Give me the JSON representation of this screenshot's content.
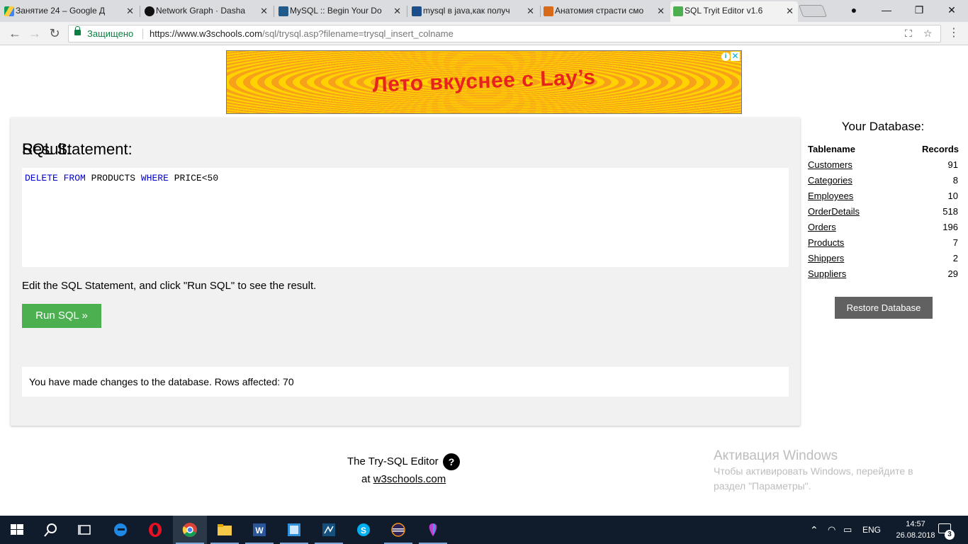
{
  "browser": {
    "tabs": [
      {
        "title": "Занятие 24 – Google Д",
        "icon": "google-drive-icon"
      },
      {
        "title": "Network Graph · Dasha",
        "icon": "github-icon"
      },
      {
        "title": "MySQL :: Begin Your Do",
        "icon": "mysql-icon"
      },
      {
        "title": "mysql в java,как получ",
        "icon": "stackoverflow-icon"
      },
      {
        "title": "Анатомия страсти смо",
        "icon": "fox-icon"
      },
      {
        "title": "SQL Tryit Editor v1.6",
        "icon": "w3schools-icon"
      }
    ],
    "secure_label": "Защищено",
    "url_host": "https://www.w3schools.com",
    "url_path": "/sql/trysql.asp?filename=trysql_insert_colname"
  },
  "ad": {
    "text": "Лето вкуснее с Lay’s"
  },
  "editor": {
    "heading": "SQL Statement:",
    "sql_kw1": "DELETE",
    "sql_kw2": "FROM",
    "sql_table": "PRODUCTS",
    "sql_kw3": "WHERE",
    "sql_cond": "PRICE<50",
    "hint": "Edit the SQL Statement, and click \"Run SQL\" to see the result.",
    "run_label": "Run SQL »",
    "result_heading": "Result:",
    "result_text": "You have made changes to the database. Rows affected: 70"
  },
  "database": {
    "title": "Your Database:",
    "col_name": "Tablename",
    "col_records": "Records",
    "tables": [
      {
        "name": "Customers",
        "records": "91"
      },
      {
        "name": "Categories",
        "records": "8"
      },
      {
        "name": "Employees",
        "records": "10"
      },
      {
        "name": "OrderDetails",
        "records": "518"
      },
      {
        "name": "Orders",
        "records": "196"
      },
      {
        "name": "Products",
        "records": "7"
      },
      {
        "name": "Shippers",
        "records": "2"
      },
      {
        "name": "Suppliers",
        "records": "29"
      }
    ],
    "restore_label": "Restore Database"
  },
  "footer": {
    "line1": "The Try-SQL Editor",
    "help": "?",
    "at": "at",
    "link": "w3schools.com"
  },
  "watermark": {
    "title": "Активация Windows",
    "line1": "Чтобы активировать Windows, перейдите в",
    "line2": "раздел \"Параметры\"."
  },
  "taskbar": {
    "lang": "ENG",
    "time": "14:57",
    "date": "26.08.2018",
    "notifications": "3"
  },
  "colors": {
    "run_button": "#4caf50",
    "restore_button": "#616161",
    "taskbar": "#101c2c",
    "sql_keyword": "#0000cd"
  }
}
